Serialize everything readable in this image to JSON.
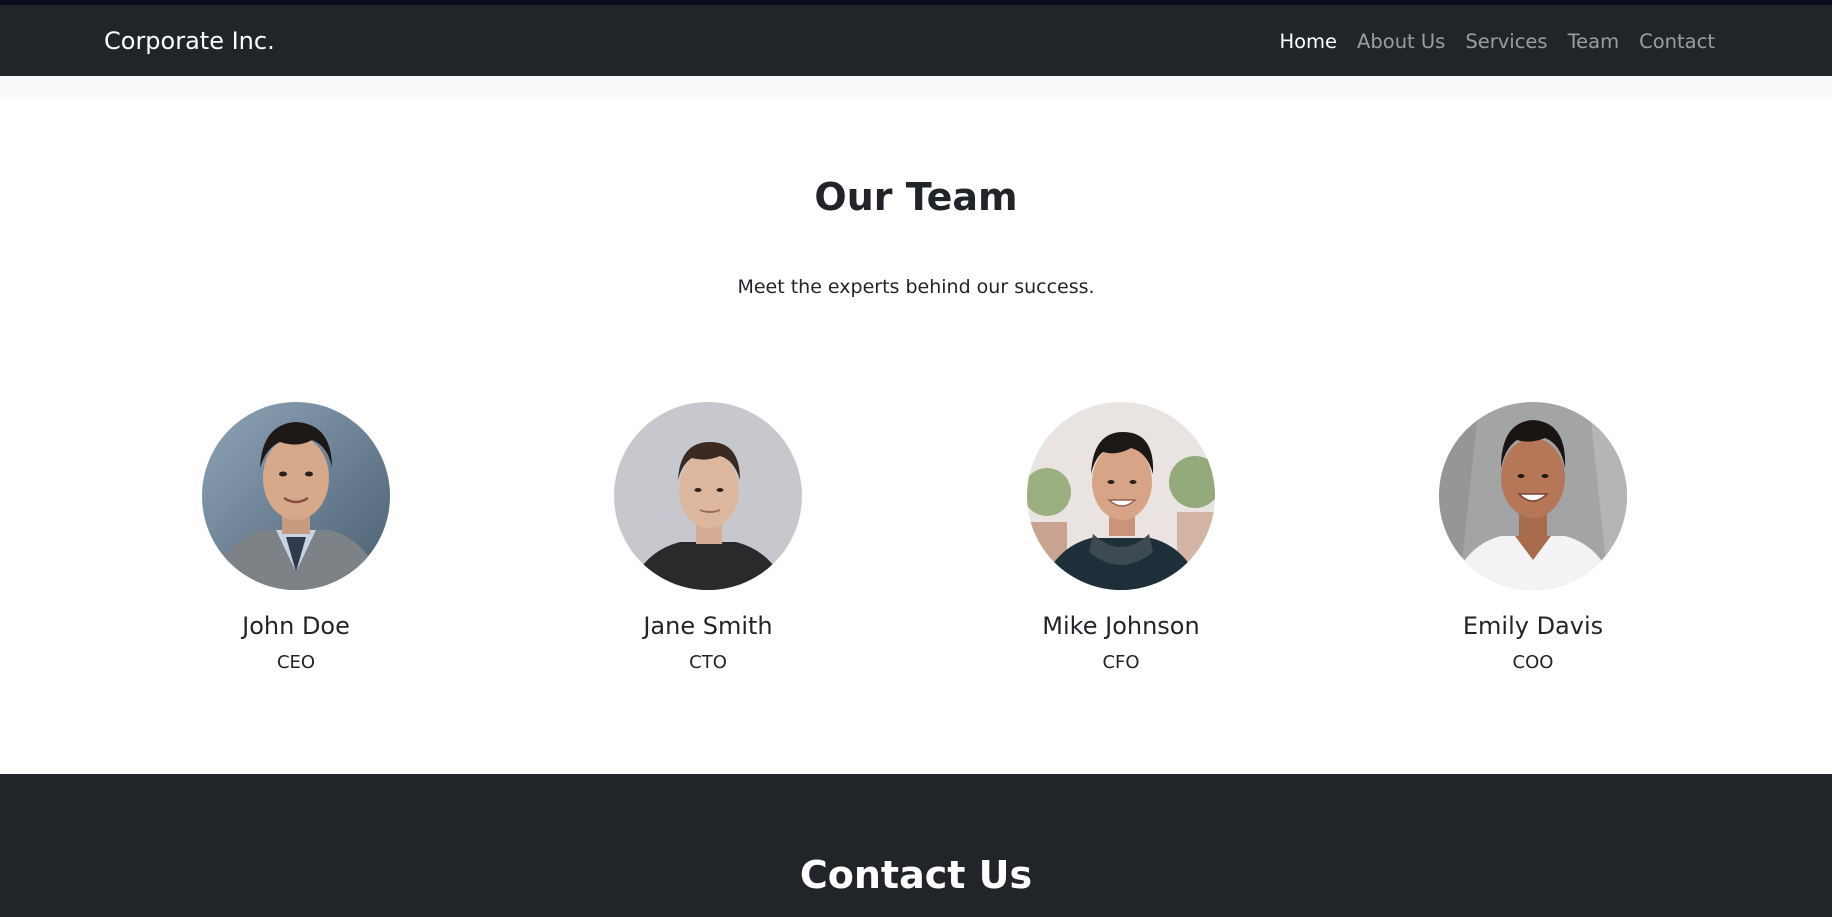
{
  "navbar": {
    "brand": "Corporate Inc.",
    "links": [
      {
        "label": "Home",
        "active": true
      },
      {
        "label": "About Us",
        "active": false
      },
      {
        "label": "Services",
        "active": false
      },
      {
        "label": "Team",
        "active": false
      },
      {
        "label": "Contact",
        "active": false
      }
    ]
  },
  "team": {
    "title": "Our Team",
    "subtitle": "Meet the experts behind our success.",
    "members": [
      {
        "name": "John Doe",
        "role": "CEO"
      },
      {
        "name": "Jane Smith",
        "role": "CTO"
      },
      {
        "name": "Mike Johnson",
        "role": "CFO"
      },
      {
        "name": "Emily Davis",
        "role": "COO"
      }
    ]
  },
  "contact": {
    "title": "Contact Us"
  },
  "colors": {
    "navbar_bg": "#212529",
    "section_light": "#f8f9fa",
    "text_dark": "#212529",
    "footer_bg": "#212529"
  }
}
